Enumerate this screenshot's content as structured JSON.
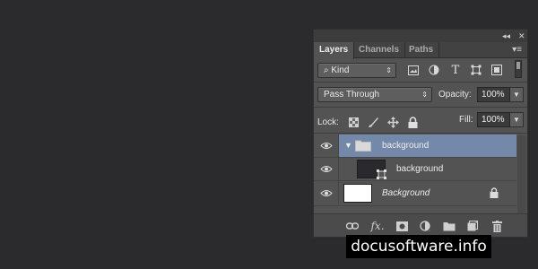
{
  "titlebar": {
    "collapse_icon": "◂◂",
    "close_icon": "✕"
  },
  "tabs": [
    {
      "label": "Layers",
      "active": true
    },
    {
      "label": "Channels",
      "active": false
    },
    {
      "label": "Paths",
      "active": false
    }
  ],
  "filter": {
    "label": "Kind",
    "icons": [
      "image-filter-icon",
      "adjustment-filter-icon",
      "type-filter-icon",
      "shape-filter-icon",
      "smart-object-filter-icon"
    ]
  },
  "blend": {
    "mode": "Pass Through",
    "opacity_label": "Opacity:",
    "opacity_value": "100%"
  },
  "lock": {
    "label": "Lock:",
    "fill_label": "Fill:",
    "fill_value": "100%"
  },
  "layers": [
    {
      "name": "background",
      "kind": "group",
      "selected": true
    },
    {
      "name": "background",
      "kind": "shape",
      "selected": false
    },
    {
      "name": "Background",
      "kind": "background",
      "selected": false
    }
  ],
  "watermark": "docusoftware.info",
  "colors": {
    "panel": "#535353",
    "selected_row": "#7489a9",
    "page_bg": "#2b2b2e"
  }
}
